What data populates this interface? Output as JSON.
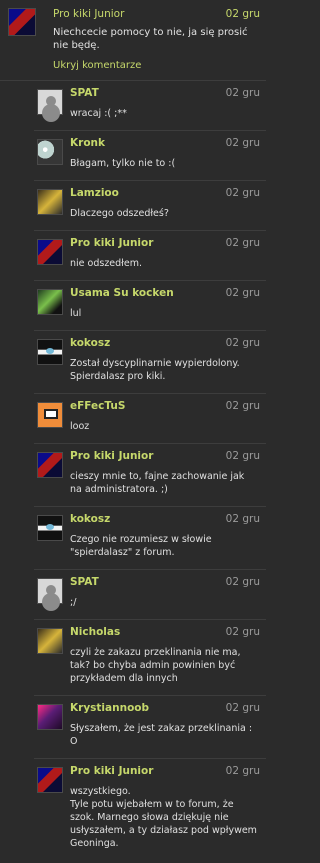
{
  "top": {
    "name": "Pro kiki Junior",
    "date": "02 gru",
    "text": "Niechcecie pomocy to nie, ja się prosić nie będę.",
    "hide": "Ukryj komentarze"
  },
  "comments": [
    {
      "name": "SPAT",
      "date": "02 gru",
      "text": "wracaj :( ;**",
      "icon": "default-avatar-icon"
    },
    {
      "name": "Kronk",
      "date": "02 gru",
      "text": "Błagam, tylko nie to :(",
      "icon": "kronk-avatar-icon"
    },
    {
      "name": "Lamzioo",
      "date": "02 gru",
      "text": "Dlaczego odszedłeś?",
      "icon": "lamzioo-avatar-icon"
    },
    {
      "name": "Pro kiki Junior",
      "date": "02 gru",
      "text": "nie odszedłem.",
      "icon": "pro-kiki-junior-avatar-icon"
    },
    {
      "name": "Usama Su kocken",
      "date": "02 gru",
      "text": "lul",
      "icon": "usama-avatar-icon"
    },
    {
      "name": "kokosz",
      "date": "02 gru",
      "text": "Został dyscyplinarnie wypierdolony. Spierdalasz pro kiki.",
      "icon": "kokosz-avatar-icon"
    },
    {
      "name": "eFFecTuS",
      "date": "02 gru",
      "text": "looz",
      "icon": "effectus-avatar-icon"
    },
    {
      "name": "Pro kiki Junior",
      "date": "02 gru",
      "text": "cieszy mnie to, fajne zachowanie jak na administratora. ;)",
      "icon": "pro-kiki-junior-avatar-icon"
    },
    {
      "name": "kokosz",
      "date": "02 gru",
      "text": "Czego nie rozumiesz w słowie \"spierdalasz\" z forum.",
      "icon": "kokosz-avatar-icon"
    },
    {
      "name": "SPAT",
      "date": "02 gru",
      "text": ";/",
      "icon": "default-avatar-icon"
    },
    {
      "name": "Nicholas",
      "date": "02 gru",
      "text": "czyli że zakazu przeklinania nie ma, tak? bo chyba admin powinien być przykładem dla innych",
      "icon": "nicholas-avatar-icon"
    },
    {
      "name": "Krystiannoob",
      "date": "02 gru",
      "text": "Słyszałem, że jest zakaz przeklinania : O",
      "icon": "krystiannoob-avatar-icon"
    },
    {
      "name": "Pro kiki Junior",
      "date": "02 gru",
      "text": "wszystkiego.\nTyle potu wjebałem w to forum, że szok. Marnego słowa dziękuję nie usłyszałem, a ty działasz pod wpływem Geoninga.",
      "icon": "pro-kiki-junior-avatar-icon"
    }
  ]
}
